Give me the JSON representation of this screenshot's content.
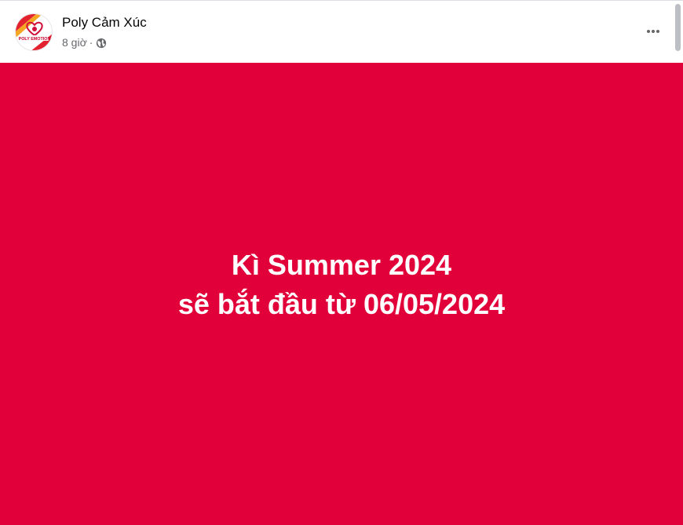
{
  "page": {
    "name": "Poly Cảm Xúc",
    "timestamp": "8 giờ",
    "separator": "·",
    "audience_icon": "globe-icon",
    "avatar_logo_text": "POLY EMOTION",
    "more_icon": "more-horizontal-icon"
  },
  "post": {
    "background_color": "#e1003a",
    "lines": [
      "Kì Summer 2024",
      "sẽ bắt đầu từ 06/05/2024"
    ]
  }
}
